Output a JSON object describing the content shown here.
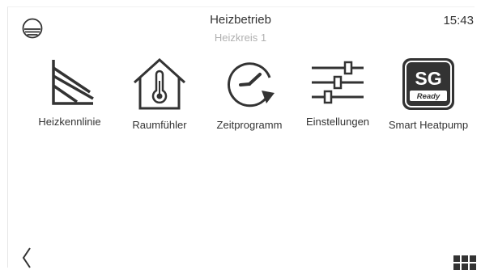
{
  "header": {
    "title": "Heizbetrieb",
    "subtitle": "Heizkreis 1",
    "time": "15:43",
    "mode_icon": "heating-mode-icon"
  },
  "tiles": [
    {
      "label": "Heizkennlinie",
      "icon": "heating-curve-icon"
    },
    {
      "label": "Raumfühler",
      "icon": "room-sensor-icon"
    },
    {
      "label": "Zeitprogramm",
      "icon": "time-program-icon"
    },
    {
      "label": "Einstellungen",
      "icon": "settings-sliders-icon"
    },
    {
      "label": "Smart Heatpump",
      "icon": "sg-ready-icon",
      "badge_text": "SG",
      "badge_subtext": "Ready"
    }
  ],
  "footer": {
    "back_icon": "chevron-left-icon",
    "menu_icon": "grid-menu-icon"
  },
  "colors": {
    "icon": "#333333",
    "subtitle": "#b0b0b0"
  }
}
